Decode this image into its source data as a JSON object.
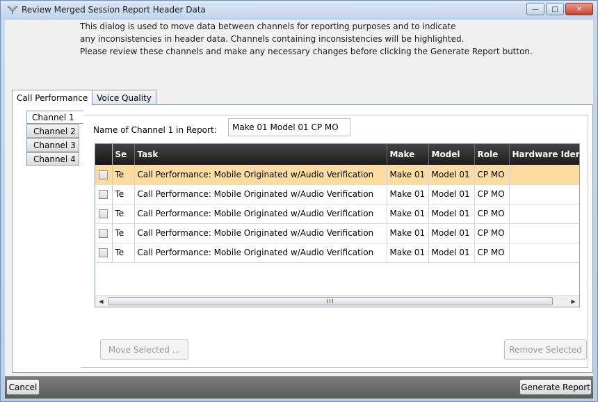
{
  "window": {
    "title": "Review Merged Session Report Header Data",
    "controls": {
      "minimize": "—",
      "maximize": "□",
      "close": "✕"
    }
  },
  "intro": {
    "line1": "This dialog is used to move data between channels for reporting purposes and to indicate",
    "line2": "any inconsistencies in header data. Channels containing inconsistencies will be highlighted.",
    "line3": "Please review these channels and make any necessary changes before clicking the Generate Report button."
  },
  "tabs": [
    "Call Performance",
    "Voice Quality"
  ],
  "active_tab": "Call Performance",
  "channels": [
    "Channel 1",
    "Channel 2",
    "Channel 3",
    "Channel 4"
  ],
  "active_channel": "Channel 1",
  "name_field": {
    "label": "Name of Channel 1 in Report:",
    "value": "Make 01 Model 01 CP MO"
  },
  "grid": {
    "columns": [
      "",
      "Se",
      "Task",
      "Make",
      "Model",
      "Role",
      "Hardware Identifi"
    ],
    "rows": [
      {
        "checked": false,
        "selected": true,
        "se": "Te",
        "task": "Call Performance: Mobile Originated w/Audio Verification",
        "make": "Make 01",
        "model": "Model 01",
        "role": "CP MO",
        "hw": ""
      },
      {
        "checked": false,
        "selected": false,
        "se": "Te",
        "task": "Call Performance: Mobile Originated w/Audio Verification",
        "make": "Make 01",
        "model": "Model 01",
        "role": "CP MO",
        "hw": ""
      },
      {
        "checked": false,
        "selected": false,
        "se": "Te",
        "task": "Call Performance: Mobile Originated w/Audio Verification",
        "make": "Make 01",
        "model": "Model 01",
        "role": "CP MO",
        "hw": ""
      },
      {
        "checked": false,
        "selected": false,
        "se": "Te",
        "task": "Call Performance: Mobile Originated w/Audio Verification",
        "make": "Make 01",
        "model": "Model 01",
        "role": "CP MO",
        "hw": ""
      },
      {
        "checked": false,
        "selected": false,
        "se": "Te",
        "task": "Call Performance: Mobile Originated w/Audio Verification",
        "make": "Make 01",
        "model": "Model 01",
        "role": "CP MO",
        "hw": ""
      }
    ]
  },
  "buttons": {
    "move_selected": "Move Selected ...",
    "remove_selected": "Remove Selected",
    "cancel": "Cancel",
    "generate_report": "Generate Report"
  },
  "colors": {
    "selected_row": "#fcdca0",
    "header_bg": "#1c1c1c",
    "footer_bg": "#6a6a6a"
  }
}
